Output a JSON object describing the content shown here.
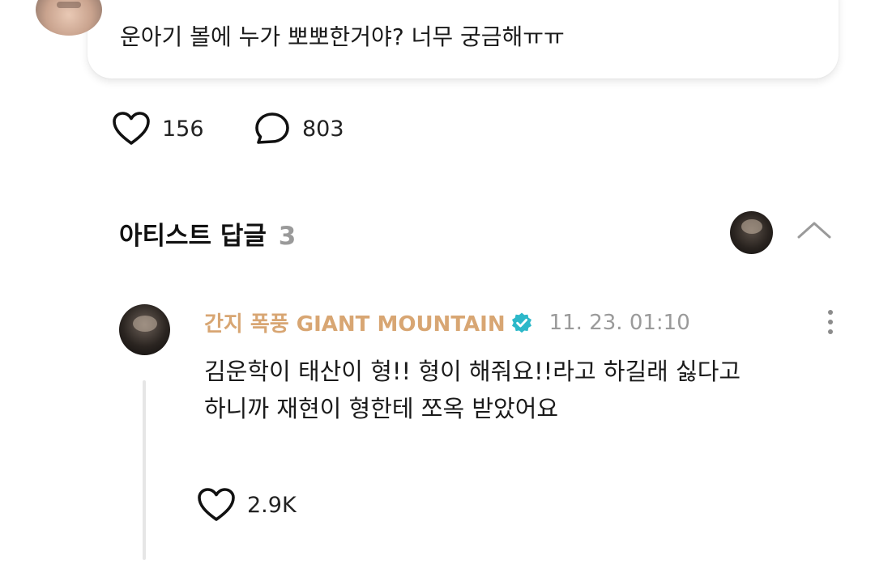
{
  "fan_comment": {
    "text": "운아기 볼에 누가 뽀뽀한거야? 너무 궁금해ㅠㅠ",
    "likes": "156",
    "replies": "803"
  },
  "artist_replies": {
    "title": "아티스트 답글",
    "count": "3"
  },
  "reply": {
    "author": "간지 폭풍 GIANT MOUNTAIN",
    "timestamp": "11. 23. 01:10",
    "body_line1": "김운학이 태산이 형!! 형이 해줘요!!라고 하길래 싫다고",
    "body_line2": "하니까 재현이 형한테 쪼옥 받았어요",
    "likes": "2.9K"
  },
  "colors": {
    "artist_name": "#d8a673",
    "verified_badge": "#2cb8c9",
    "muted": "#9a9a9a"
  },
  "icons": {
    "like": "heart-outline-icon",
    "comment": "speech-bubble-icon",
    "collapse": "chevron-up-icon",
    "verified": "verified-badge-icon",
    "more": "vertical-dots-icon"
  }
}
